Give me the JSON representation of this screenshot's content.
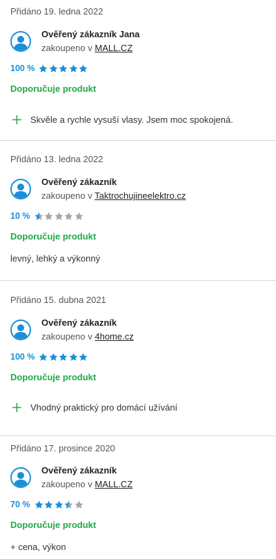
{
  "colors": {
    "accent": "#1a8fd8",
    "recommend": "#1eaa4b",
    "star_empty": "#a6a6a6",
    "divider": "#d9d9d9"
  },
  "icons": {
    "avatar": "user-avatar-icon",
    "star": "star-icon",
    "pro": "plus-icon"
  },
  "reviews": [
    {
      "date": "Přidáno 19. ledna 2022",
      "name": "Ověřený zákazník Jana",
      "purchased_prefix": "zakoupeno v",
      "shop": "MALL.CZ",
      "rating_pct": "100 %",
      "rating_value": 5,
      "recommend": "Doporučuje produkt",
      "pro": "Skvěle a rychle vysuší vlasy. Jsem moc spokojená."
    },
    {
      "date": "Přidáno 13. ledna 2022",
      "name": "Ověřený zákazník",
      "purchased_prefix": "zakoupeno v",
      "shop": "Taktrochujineelektro.cz",
      "rating_pct": "10 %",
      "rating_value": 0.5,
      "recommend": "Doporučuje produkt",
      "text": "levný, lehký a výkonný"
    },
    {
      "date": "Přidáno 15. dubna 2021",
      "name": "Ověřený zákazník",
      "purchased_prefix": "zakoupeno v",
      "shop": "4home.cz",
      "rating_pct": "100 %",
      "rating_value": 5,
      "recommend": "Doporučuje produkt",
      "pro": "Vhodný praktický pro domácí užívání"
    },
    {
      "date": "Přidáno 17. prosince 2020",
      "name": "Ověřený zákazník",
      "purchased_prefix": "zakoupeno v",
      "shop": "MALL.CZ",
      "rating_pct": "70 %",
      "rating_value": 3.5,
      "recommend": "Doporučuje produkt",
      "text": "+ cena, výkon"
    }
  ]
}
